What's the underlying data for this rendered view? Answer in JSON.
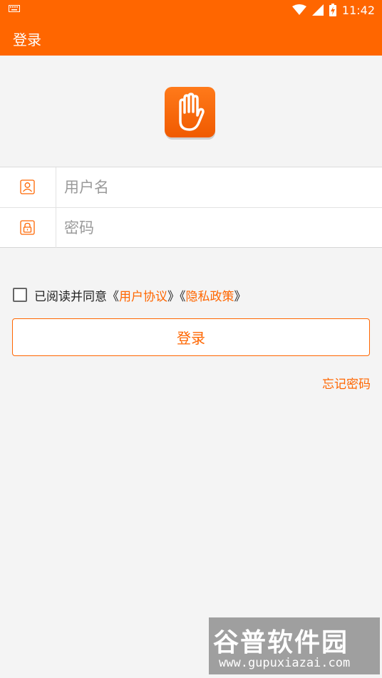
{
  "status_bar": {
    "time": "11:42",
    "icons": [
      "keyboard-icon",
      "wifi-icon",
      "signal-icon",
      "battery-charging-icon"
    ]
  },
  "app_bar": {
    "title": "登录"
  },
  "logo": {
    "icon": "hand-stop-icon",
    "color": "#ff6600"
  },
  "form": {
    "username": {
      "value": "",
      "placeholder": "用户名",
      "icon": "user-icon"
    },
    "password": {
      "value": "",
      "placeholder": "密码",
      "icon": "lock-icon"
    }
  },
  "agreement": {
    "checked": false,
    "prefix": "已阅读并同意《",
    "user_agreement": "用户协议",
    "middle": "》《",
    "privacy_policy": "隐私政策",
    "suffix": "》"
  },
  "login_button": {
    "label": "登录"
  },
  "forgot_password": {
    "label": "忘记密码"
  },
  "watermark": {
    "title": "谷普软件园",
    "url": "www.gupuxiazai.com"
  },
  "colors": {
    "accent": "#ff6600",
    "background": "#f4f4f4"
  }
}
